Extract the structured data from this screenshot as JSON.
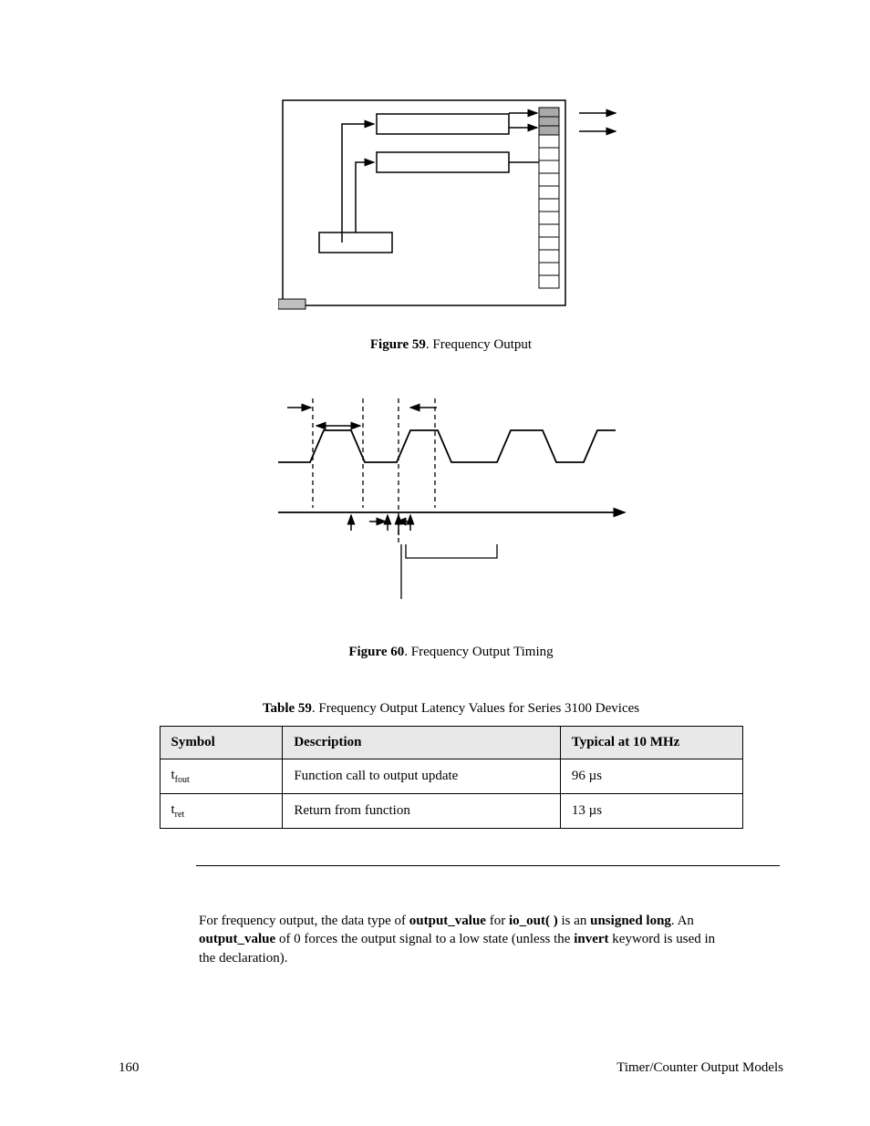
{
  "figure59": {
    "label": "Figure 59",
    "caption": ". Frequency Output"
  },
  "figure60": {
    "label": "Figure 60",
    "caption": ". Frequency Output Timing"
  },
  "table59": {
    "label": "Table 59",
    "caption": ". Frequency Output Latency Values for Series 3100 Devices",
    "headers": {
      "symbol": "Symbol",
      "description": "Description",
      "typical": "Typical at 10 MHz"
    },
    "rows": [
      {
        "symbol_prefix": "t",
        "symbol_sub": "fout",
        "description": "Function call to output update",
        "typical": "96 µs"
      },
      {
        "symbol_prefix": "t",
        "symbol_sub": "ret",
        "description": "Return from function",
        "typical": "13 µs"
      }
    ]
  },
  "paragraph": {
    "p1a": "For frequency output, the data type of ",
    "p1b": "output_value",
    "p1c": " for ",
    "p1d": "io_out( )",
    "p1e": " is an ",
    "p1f": "unsigned long",
    "p1g": ".  An ",
    "p1h": "output_value",
    "p1i": " of 0 forces the output signal to a low state (unless the ",
    "p1j": "invert",
    "p1k": " keyword is used in the declaration)."
  },
  "footer": {
    "page": "160",
    "section": "Timer/Counter Output Models"
  }
}
